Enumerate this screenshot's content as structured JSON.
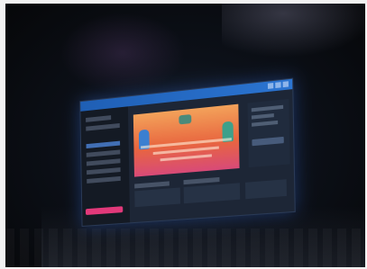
{
  "scene": {
    "window_title": "",
    "sidebar_items": 6,
    "cta_color": "#e2397a",
    "hero_colors": [
      "#f3a25a",
      "#e8663f",
      "#d84a78"
    ],
    "accent": "#2b74d1"
  }
}
